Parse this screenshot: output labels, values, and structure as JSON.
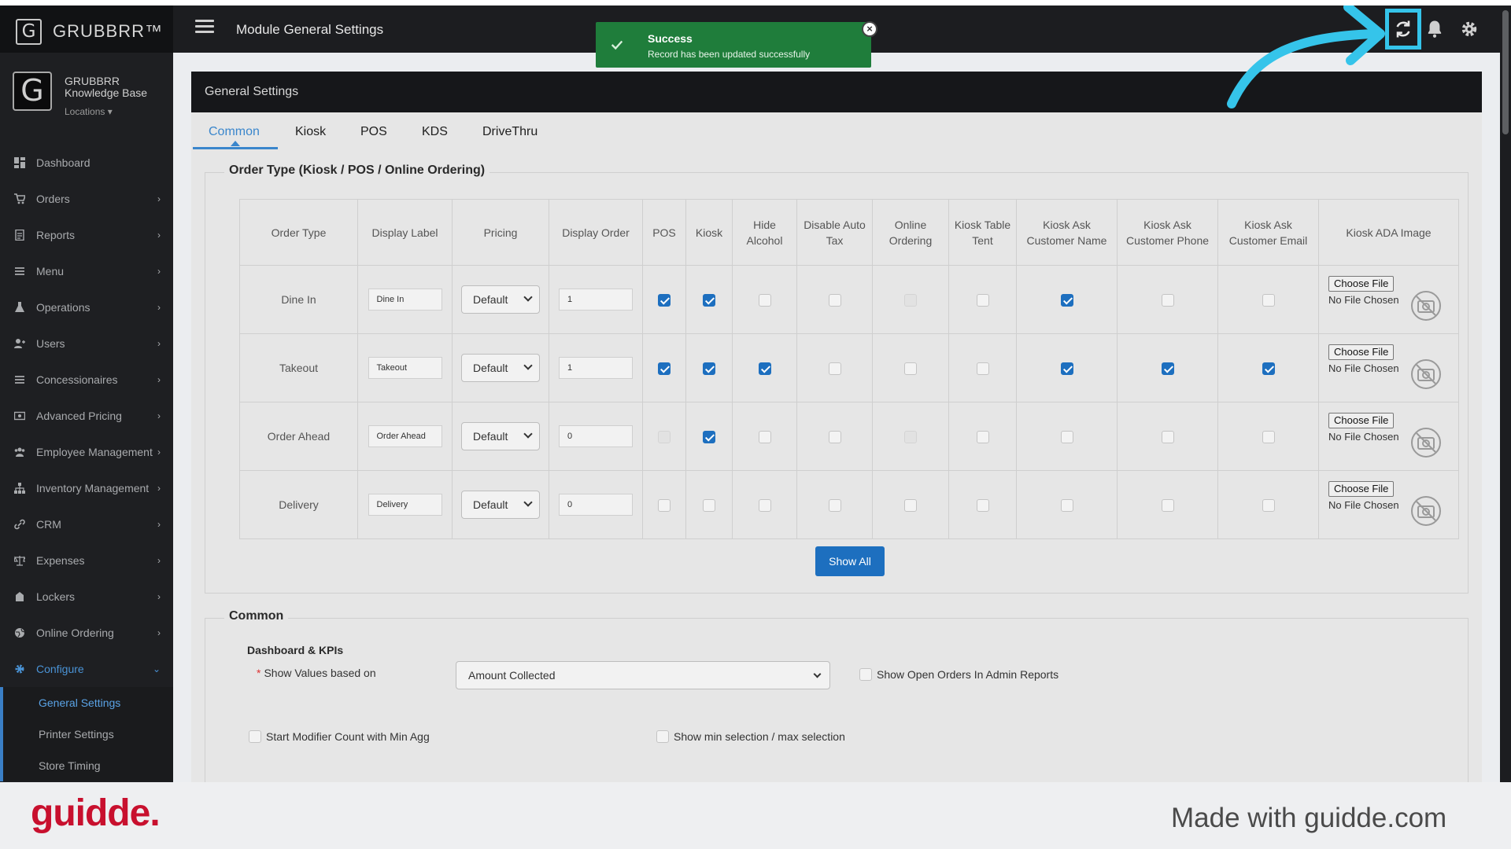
{
  "app": {
    "brand": "GRUBBRR™",
    "brand_letter": "G",
    "page_heading": "Module General Settings"
  },
  "toast": {
    "title": "Success",
    "message": "Record has been updated successfully",
    "close_glyph": "×",
    "color": "#1f7d3b"
  },
  "profile": {
    "logo_letter": "G",
    "line1": "GRUBBRR",
    "line2": "Knowledge Base",
    "locations": "Locations ▾"
  },
  "sidebar": {
    "items": [
      {
        "label": "Dashboard",
        "icon": "dashboard-icon",
        "chev": ""
      },
      {
        "label": "Orders",
        "icon": "cart-icon",
        "chev": "›"
      },
      {
        "label": "Reports",
        "icon": "report-icon",
        "chev": "›"
      },
      {
        "label": "Menu",
        "icon": "list-icon",
        "chev": "›"
      },
      {
        "label": "Operations",
        "icon": "flask-icon",
        "chev": "›"
      },
      {
        "label": "Users",
        "icon": "users-icon",
        "chev": "›"
      },
      {
        "label": "Concessionaires",
        "icon": "list-icon",
        "chev": "›"
      },
      {
        "label": "Advanced Pricing",
        "icon": "money-icon",
        "chev": "›"
      },
      {
        "label": "Employee Management",
        "icon": "group-icon",
        "chev": "›"
      },
      {
        "label": "Inventory Management",
        "icon": "sitemap-icon",
        "chev": "›"
      },
      {
        "label": "CRM",
        "icon": "link-icon",
        "chev": "›"
      },
      {
        "label": "Expenses",
        "icon": "scale-icon",
        "chev": "›"
      },
      {
        "label": "Lockers",
        "icon": "lockers-icon",
        "chev": "›"
      },
      {
        "label": "Online Ordering",
        "icon": "globe-icon",
        "chev": "›"
      },
      {
        "label": "Configure",
        "icon": "gear-icon",
        "chev": "⌄"
      }
    ],
    "sub_items": [
      "General Settings",
      "Printer Settings",
      "Store Timing"
    ]
  },
  "main": {
    "card_title": "General Settings",
    "tabs": [
      "Common",
      "Kiosk",
      "POS",
      "KDS",
      "DriveThru"
    ],
    "order_type_legend": "Order Type (Kiosk / POS / Online Ordering)",
    "table": {
      "headers": [
        "Order Type",
        "Display Label",
        "Pricing",
        "Display Order",
        "POS",
        "Kiosk",
        "Hide Alcohol",
        "Disable Auto Tax",
        "Online Ordering",
        "Kiosk Table Tent",
        "Kiosk Ask Customer Name",
        "Kiosk Ask Customer Phone",
        "Kiosk Ask Customer Email",
        "Kiosk ADA Image"
      ],
      "rows": [
        {
          "type": "Dine In",
          "label": "Dine In",
          "pricing": "Default",
          "order": "1",
          "checks": [
            "on",
            "on",
            "off",
            "off",
            "dis",
            "off",
            "on",
            "off",
            "off"
          ]
        },
        {
          "type": "Takeout",
          "label": "Takeout",
          "pricing": "Default",
          "order": "1",
          "checks": [
            "on",
            "on",
            "on",
            "off",
            "off",
            "off",
            "on",
            "on",
            "on"
          ]
        },
        {
          "type": "Order Ahead",
          "label": "Order Ahead",
          "pricing": "Default",
          "order": "0",
          "checks": [
            "dis",
            "on",
            "off",
            "off",
            "dis",
            "off",
            "off",
            "off",
            "off"
          ]
        },
        {
          "type": "Delivery",
          "label": "Delivery",
          "pricing": "Default",
          "order": "0",
          "checks": [
            "off",
            "off",
            "off",
            "off",
            "off",
            "off",
            "off",
            "off",
            "off"
          ]
        }
      ],
      "file_button": "Choose File",
      "file_status": "No File Chosen"
    },
    "show_all": "Show All",
    "common_legend": "Common",
    "dashboard_kpis": "Dashboard & KPIs",
    "show_values_label": "Show Values based on",
    "required_mark": "*",
    "show_values_value": "Amount Collected",
    "open_orders_label": "Show Open Orders In Admin Reports",
    "modifier_label": "Start Modifier Count with Min Agg",
    "minmax_label": "Show min selection / max selection"
  },
  "footer": {
    "logo": "guidde.",
    "tagline": "Made with guidde.com"
  },
  "colors": {
    "accent": "#1d6fbf",
    "highlight": "#35c4ea",
    "brand_red": "#c8102e"
  }
}
